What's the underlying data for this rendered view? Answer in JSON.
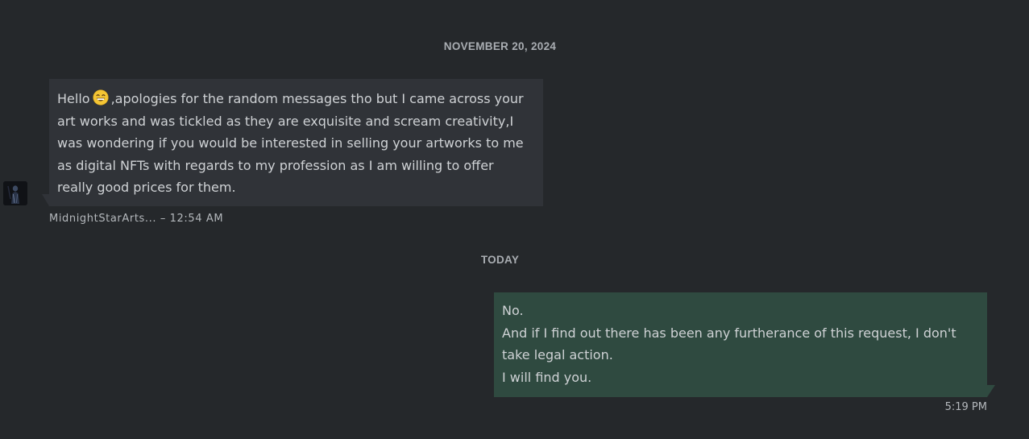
{
  "date_separators": {
    "first": "NOVEMBER 20, 2024",
    "second": "TODAY"
  },
  "incoming_message": {
    "sender": "MidnightStarArts...",
    "time": "12:54 AM",
    "lines": {
      "l1_before_emoji": "Hello",
      "l1_after_emoji": ",apologies for the random messages tho but I came across your",
      "l2": "art works and was tickled as they are exquisite and scream creativity,I",
      "l3": "was wondering if you would be interested in selling your artworks to me",
      "l4": "as digital NFTs with regards to my profession as I am willing to offer",
      "l5": "really good prices for them."
    },
    "emoji": "grinning-face-with-smiling-eyes"
  },
  "outgoing_message": {
    "time": "5:19 PM",
    "lines": {
      "l1": "No.",
      "l2": "And if I find out there has been any furtherance of this request, I don't",
      "l3": "take legal action.",
      "l4": "I will find you."
    }
  },
  "colors": {
    "background": "#25282b",
    "incoming_bubble": "#303338",
    "outgoing_bubble": "#2f4a40"
  }
}
